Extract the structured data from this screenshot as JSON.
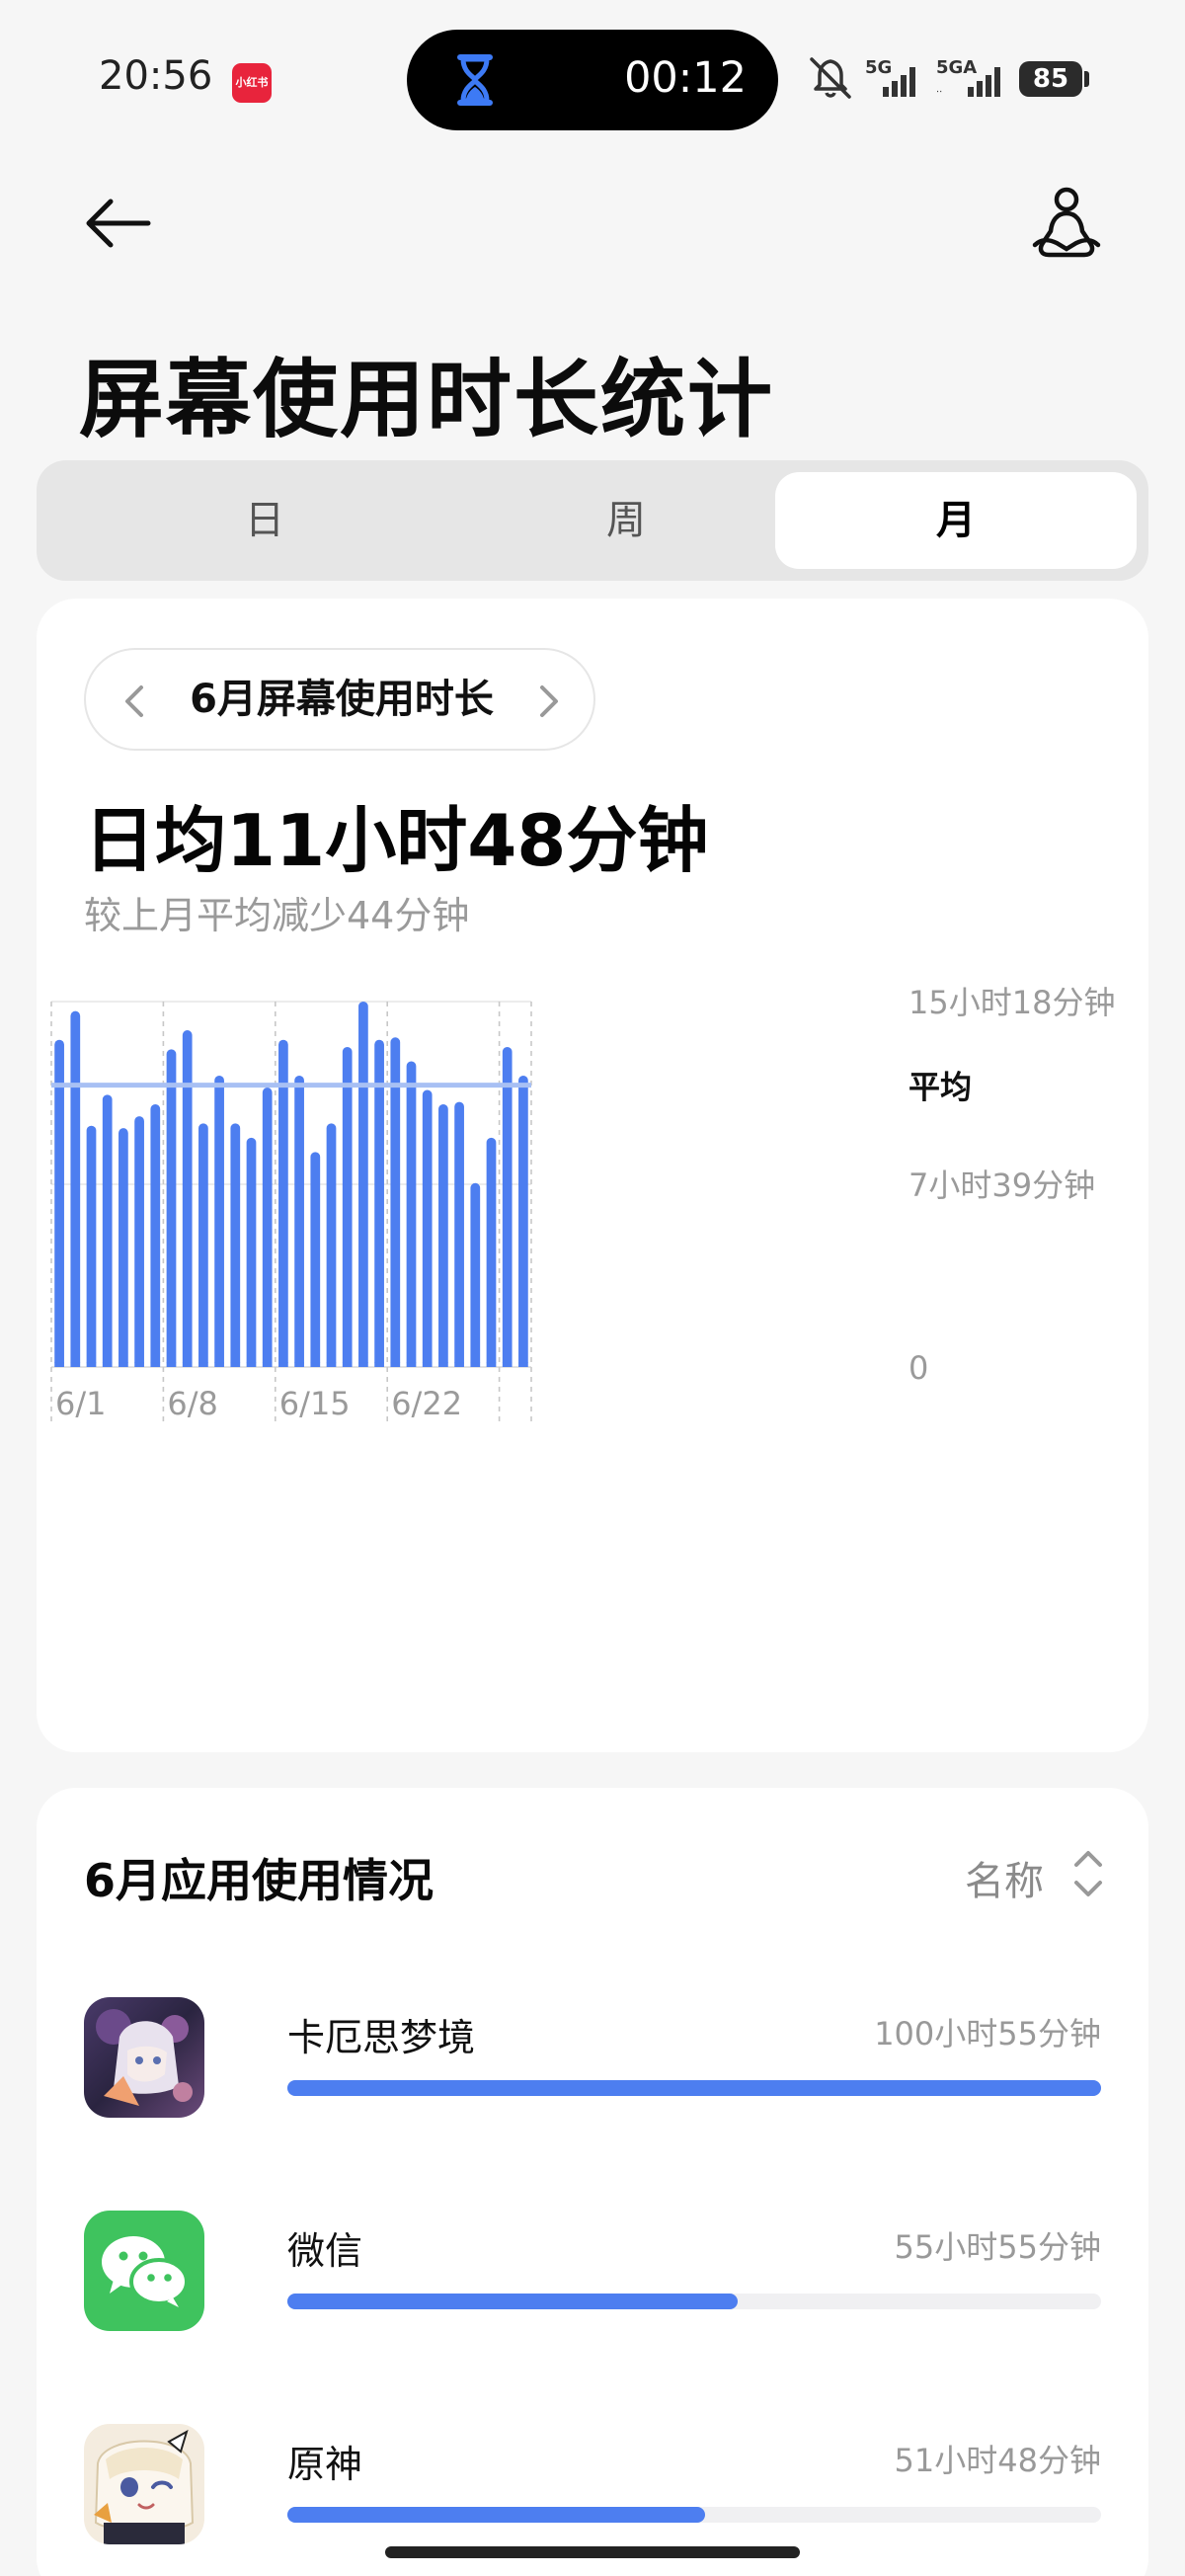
{
  "status_bar": {
    "time": "20:56",
    "app_badge": "小红书",
    "timer": "00:12",
    "battery": "85",
    "network": [
      "5G",
      "5GA"
    ]
  },
  "header": {
    "title": "屏幕使用时长统计"
  },
  "tabs": [
    {
      "label": "日",
      "selected": false
    },
    {
      "label": "周",
      "selected": false
    },
    {
      "label": "月",
      "selected": true
    }
  ],
  "summary": {
    "period_label": "6月屏幕使用时长",
    "daily_average": "日均11小时48分钟",
    "comparison": "较上月平均减少44分钟"
  },
  "chart_data": {
    "type": "bar",
    "categories": [
      "6/1",
      "6/2",
      "6/3",
      "6/4",
      "6/5",
      "6/6",
      "6/7",
      "6/8",
      "6/9",
      "6/10",
      "6/11",
      "6/12",
      "6/13",
      "6/14",
      "6/15",
      "6/16",
      "6/17",
      "6/18",
      "6/19",
      "6/20",
      "6/21",
      "6/22",
      "6/23",
      "6/24",
      "6/25",
      "6/26",
      "6/27",
      "6/28",
      "6/29",
      "6/30"
    ],
    "values": [
      13.7,
      14.9,
      10.1,
      11.4,
      10.0,
      10.5,
      11.0,
      13.3,
      14.1,
      10.2,
      12.2,
      10.2,
      9.6,
      11.7,
      13.7,
      12.2,
      9.0,
      10.2,
      13.4,
      15.3,
      13.7,
      13.8,
      12.8,
      11.6,
      11.0,
      11.1,
      7.7,
      9.6,
      13.4,
      12.2
    ],
    "value_unit": "小时",
    "average": 11.8,
    "average_label": "平均",
    "ylim": [
      0,
      15.3
    ],
    "y_ticks": [
      {
        "value": 15.3,
        "label": "15小时18分钟"
      },
      {
        "value": 7.65,
        "label": "7小时39分钟"
      },
      {
        "value": 0,
        "label": "0"
      }
    ],
    "x_tick_labels": [
      {
        "index": 0,
        "label": "6/1"
      },
      {
        "index": 7,
        "label": "6/8"
      },
      {
        "index": 14,
        "label": "6/15"
      },
      {
        "index": 21,
        "label": "6/22"
      }
    ],
    "bar_color": "#4d7ef0",
    "average_color": "#a8c0f4"
  },
  "apps_section": {
    "title": "6月应用使用情况",
    "sort_label": "名称",
    "items": [
      {
        "name": "卡厄思梦境",
        "time": "100小时55分钟",
        "fraction": 1.0
      },
      {
        "name": "微信",
        "time": "55小时55分钟",
        "fraction": 0.554
      },
      {
        "name": "原神",
        "time": "51小时48分钟",
        "fraction": 0.513
      }
    ]
  },
  "colors": {
    "accent": "#4d7ef0",
    "track": "#f0f0f2",
    "wechat_green": "#3fc35e"
  }
}
